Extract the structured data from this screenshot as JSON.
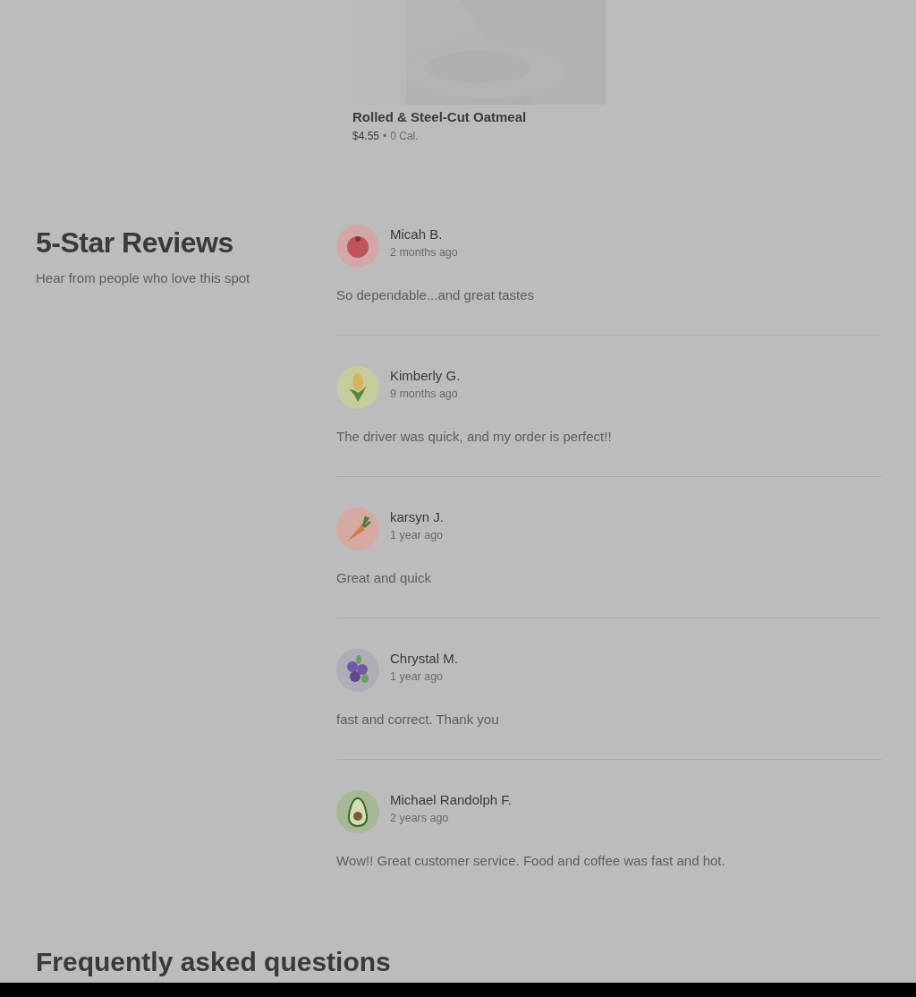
{
  "menu_item": {
    "kind": "picture",
    "name": "Rolled & Steel-Cut Oatmeal",
    "price": "$4.55",
    "separator": "•",
    "calories": "0 Cal."
  },
  "reviews_section": {
    "title": "5-Star Reviews",
    "subtitle": "Hear from people who love this spot",
    "reviews": [
      {
        "name": "Micah B.",
        "time": "2 months ago",
        "text": "So dependable...and great tastes",
        "kind": "tomato"
      },
      {
        "name": "Kimberly G.",
        "time": "9 months ago",
        "text": "The driver was quick, and my order is perfect!!",
        "kind": "corn"
      },
      {
        "name": "karsyn J.",
        "time": "1 year ago",
        "text": "Great and quick",
        "kind": "carrot"
      },
      {
        "name": "Chrystal M.",
        "time": "1 year ago",
        "text": "fast and correct. Thank you",
        "kind": "blueberry"
      },
      {
        "name": "Michael Randolph F.",
        "time": "2 years ago",
        "text": "Wow!! Great customer service. Food and coffee was fast and hot.",
        "kind": "avocado"
      }
    ]
  },
  "faq": {
    "title": "Frequently asked questions"
  }
}
